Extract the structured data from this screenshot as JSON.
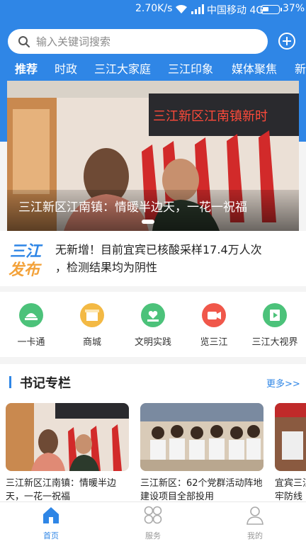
{
  "status_bar": {
    "speed": "2.70K/s",
    "carrier": "中国移动 4G",
    "battery": "37%"
  },
  "search": {
    "placeholder": "输入关键词搜索"
  },
  "tabs": [
    "推荐",
    "时政",
    "三江大家庭",
    "三江印象",
    "媒体聚焦",
    "新"
  ],
  "hero": {
    "caption": "三江新区江南镇：情暖半边天，一花一祝福",
    "banner_text": "三江新区江南镇新时"
  },
  "news": {
    "logo_line1": "三江",
    "logo_line2": "发布",
    "line1": "无新增！目前宜宾已核酸采样17.4万人次",
    "line2": "，检测结果均为阴性"
  },
  "services": [
    {
      "label": "一卡通",
      "icon": "bank-card-icon",
      "color": "#4cc27a"
    },
    {
      "label": "商城",
      "icon": "shop-icon",
      "color": "#f3b944"
    },
    {
      "label": "文明实践",
      "icon": "heart-hand-icon",
      "color": "#4cc27a"
    },
    {
      "label": "览三江",
      "icon": "video-camera-icon",
      "color": "#f0574a"
    },
    {
      "label": "三江大视界",
      "icon": "film-icon",
      "color": "#4cc27a"
    }
  ],
  "column": {
    "title": "书记专栏",
    "more": "更多>>",
    "cards": [
      {
        "title": "三江新区江南镇：情暖半边天，一花一祝福"
      },
      {
        "title": "三江新区：62个党群活动阵地建设项目全部投用"
      },
      {
        "title": "宜宾三江新区：压实责任，筑牢防线"
      }
    ]
  },
  "bottom_nav": [
    {
      "label": "首页",
      "icon": "home-icon",
      "active": true
    },
    {
      "label": "服务",
      "icon": "grid-icon",
      "active": false
    },
    {
      "label": "我的",
      "icon": "user-icon",
      "active": false
    }
  ],
  "colors": {
    "primary": "#2f86e6",
    "active_nav": "#2f86e6"
  }
}
